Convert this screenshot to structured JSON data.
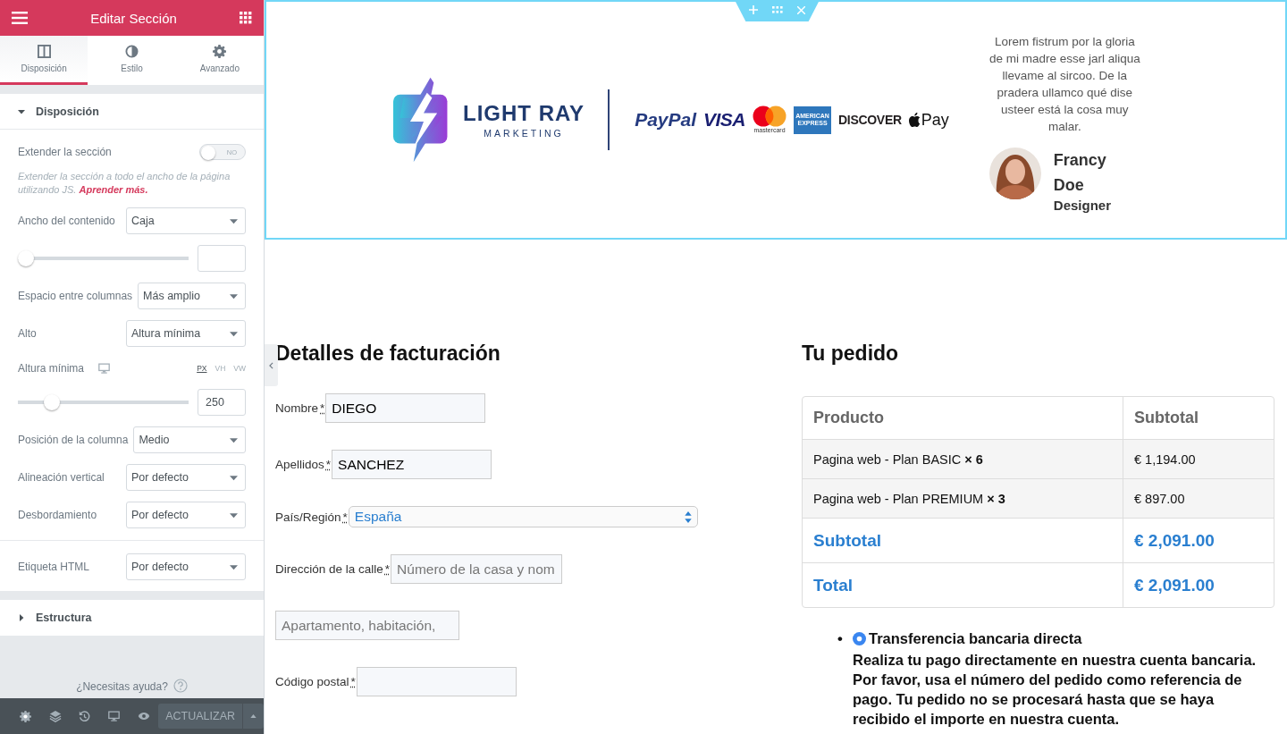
{
  "panel": {
    "title": "Editar Sección",
    "tabs": [
      {
        "label": "Disposición",
        "selected": true
      },
      {
        "label": "Estilo",
        "selected": false
      },
      {
        "label": "Avanzado",
        "selected": false
      }
    ],
    "sections": [
      {
        "title": "Disposición",
        "expanded": true,
        "controls": [
          {
            "kind": "toggle",
            "label": "Extender la sección",
            "on": false,
            "text": "NO"
          },
          {
            "kind": "note",
            "text": "Extender la sección a todo el ancho de la página utilizando JS.",
            "link": "Aprender más."
          },
          {
            "kind": "select",
            "label": "Ancho del contenido",
            "value": "Caja"
          },
          {
            "kind": "slider",
            "level": 0
          },
          {
            "kind": "select",
            "label": "Espacio entre columnas",
            "value": "Más amplio"
          },
          {
            "kind": "select",
            "label": "Alto",
            "value": "Altura mínima"
          },
          {
            "kind": "slider",
            "label": "Altura mínima",
            "units": [
              {
                "label": "PX",
                "selected": true
              },
              {
                "label": "VH",
                "selected": false
              },
              {
                "label": "VW",
                "selected": false
              }
            ],
            "level": 0.17,
            "value": "250"
          },
          {
            "kind": "select",
            "label": "Posición de la columna",
            "value": "Medio"
          },
          {
            "kind": "select",
            "label": "Alineación vertical",
            "value": "Por defecto"
          },
          {
            "kind": "select",
            "label": "Desbordamiento",
            "value": "Por defecto"
          },
          {
            "kind": "divider"
          },
          {
            "kind": "select",
            "label": "Etiqueta HTML",
            "value": "Por defecto"
          }
        ]
      },
      {
        "title": "Estructura",
        "expanded": false
      }
    ],
    "help": "¿Necesitas ayuda?",
    "footer": {
      "button": "ACTUALIZAR"
    }
  },
  "header_section": {
    "logo": {
      "name": "LIGHT RAY",
      "tagline": "MARKETING"
    },
    "payment_logos": [
      {
        "kind": "paypal",
        "text": "PayPal"
      },
      {
        "kind": "visa",
        "text": "VISA"
      },
      {
        "kind": "mastercard",
        "text": "mastercard"
      },
      {
        "kind": "amex",
        "text": "AMERICAN EXPRESS"
      },
      {
        "kind": "discover",
        "text": "DISCOVER"
      },
      {
        "kind": "applepay",
        "text": "Pay"
      }
    ],
    "testimonial": {
      "quote": "Lorem fistrum por la gloria de mi madre esse jarl aliqua llevame al sircoo. De la pradera ullamco qué dise usteer está la cosa muy malar.",
      "name": "Francy Doe",
      "role": "Designer"
    }
  },
  "billing": {
    "title": "Detalles de facturación",
    "fields": [
      {
        "kind": "text",
        "label": "Nombre",
        "mark": "*",
        "value": "DIEGO"
      },
      {
        "kind": "text",
        "label": "Apellidos",
        "mark": "*",
        "value": "SANCHEZ"
      },
      {
        "kind": "select",
        "label": "País/Región",
        "mark": "*",
        "value": "España"
      },
      {
        "kind": "text",
        "label": "Dirección de la calle",
        "mark": "*",
        "placeholder": "Número de la casa y nom"
      },
      {
        "kind": "text",
        "placeholder": "Apartamento, habitación,"
      },
      {
        "kind": "text",
        "label": "Código postal",
        "mark": "*"
      }
    ]
  },
  "order": {
    "title": "Tu pedido",
    "columns": [
      "Producto",
      "Subtotal"
    ],
    "items": [
      {
        "name": "Pagina web - Plan BASIC **× 6**",
        "total": "€ 1,194.00"
      },
      {
        "name": "Pagina web - Plan PREMIUM **× 3**",
        "total": "€ 897.00"
      }
    ],
    "totals": [
      {
        "label": "Subtotal",
        "value": "€ 2,091.00"
      },
      {
        "label": "Total",
        "value": "€ 2,091.00"
      }
    ],
    "payment_methods": [
      {
        "bullet": "•",
        "label": "Transferencia bancaria directa",
        "selected": true,
        "description": "Realiza tu pago directamente en nuestra cuenta bancaria. Por favor, usa el número del pedido como referencia de pago. Tu pedido no se procesará hasta que se haya recibido el importe en nuestra cuenta."
      }
    ]
  }
}
